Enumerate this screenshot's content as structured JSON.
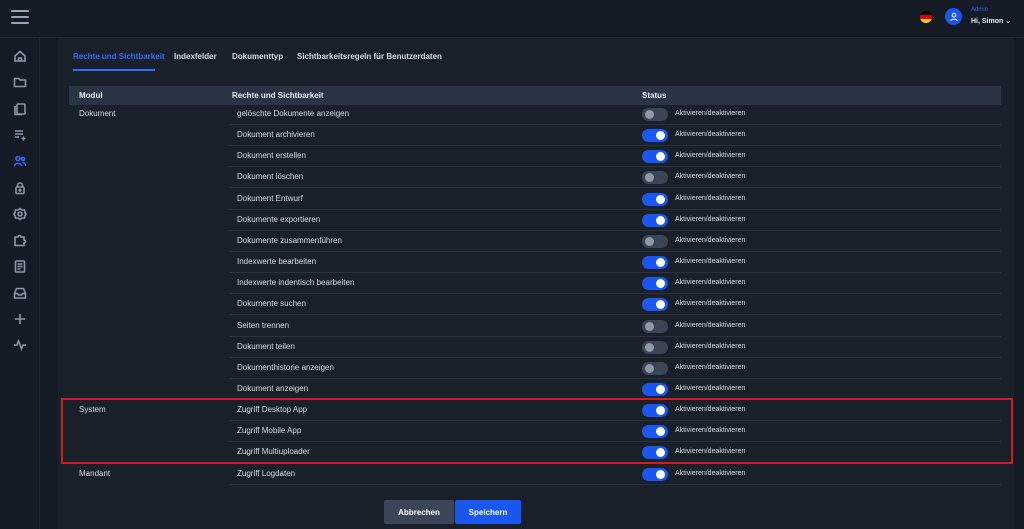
{
  "header": {
    "user_role": "Admin",
    "user_greeting": "Hi, Simon",
    "chevron": "⌄",
    "flag_colors": [
      "#000000",
      "#dd0000",
      "#ffce00"
    ]
  },
  "sidebar": {
    "icons": [
      "home-icon",
      "folder-icon",
      "documents-icon",
      "list-add-icon",
      "users-icon",
      "lock-icon",
      "settings-badge-icon",
      "puzzle-icon",
      "clipboard-icon",
      "inbox-icon",
      "plus-icon",
      "activity-icon"
    ],
    "active": "users-icon"
  },
  "tabs": [
    {
      "label": "Rechte und Sichtbarkeit",
      "active": true
    },
    {
      "label": "Indexfelder",
      "active": false
    },
    {
      "label": "Dokumenttyp",
      "active": false
    },
    {
      "label": "Sichtbarkeitsregeln für Benutzerdaten",
      "active": false
    }
  ],
  "table": {
    "headers": {
      "module": "Modul",
      "right": "Rechte und Sichtbarkeit",
      "status": "Status"
    },
    "toggle_label": "Aktivieren/deaktivieren",
    "rows": [
      {
        "module": "Dokument",
        "right": "gelöschte Dokumente anzeigen",
        "on": false
      },
      {
        "module": "",
        "right": "Dokument archivieren",
        "on": true
      },
      {
        "module": "",
        "right": "Dokument erstellen",
        "on": true
      },
      {
        "module": "",
        "right": "Dokument löschen",
        "on": false
      },
      {
        "module": "",
        "right": "Dokument Entwurf",
        "on": true
      },
      {
        "module": "",
        "right": "Dokumente exportieren",
        "on": true
      },
      {
        "module": "",
        "right": "Dokumente zusammenführen",
        "on": false
      },
      {
        "module": "",
        "right": "Indexwerte bearbeiten",
        "on": true
      },
      {
        "module": "",
        "right": "Indexwerte indentisch bearbeiten",
        "on": true
      },
      {
        "module": "",
        "right": "Dokumente suchen",
        "on": true
      },
      {
        "module": "",
        "right": "Seiten trennen",
        "on": false
      },
      {
        "module": "",
        "right": "Dokument teilen",
        "on": false
      },
      {
        "module": "",
        "right": "Dokumenthistorie anzeigen",
        "on": false
      },
      {
        "module": "",
        "right": "Dokument anzeigen",
        "on": true
      },
      {
        "module": "System",
        "right": "Zugriff Desktop App",
        "on": true
      },
      {
        "module": "",
        "right": "Zugriff Mobile App",
        "on": true
      },
      {
        "module": "",
        "right": "Zugriff Multiuploader",
        "on": true
      },
      {
        "module": "Mandant",
        "right": "Zugriff Logdaten",
        "on": true
      }
    ]
  },
  "buttons": {
    "cancel": "Abbrechen",
    "save": "Speichern"
  },
  "colors": {
    "accent": "#1a56f0",
    "highlight": "#d01e1e",
    "background": "#151b24",
    "panel": "#1a2029"
  }
}
